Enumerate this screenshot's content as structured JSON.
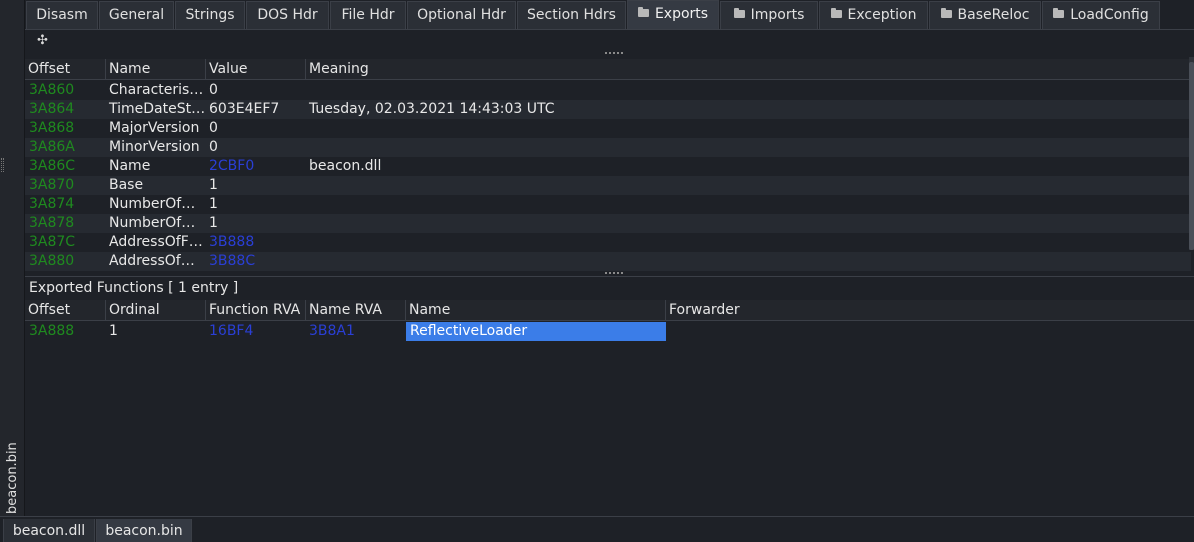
{
  "tabs": [
    {
      "label": "Disasm",
      "folder": false
    },
    {
      "label": "General",
      "folder": false
    },
    {
      "label": "Strings",
      "folder": false
    },
    {
      "label": "DOS Hdr",
      "folder": false
    },
    {
      "label": "File Hdr",
      "folder": false
    },
    {
      "label": "Optional Hdr",
      "folder": false
    },
    {
      "label": "Section Hdrs",
      "folder": false
    },
    {
      "label": "Exports",
      "folder": true,
      "active": true
    },
    {
      "label": "Imports",
      "folder": true
    },
    {
      "label": "Exception",
      "folder": true
    },
    {
      "label": "BaseReloc",
      "folder": true
    },
    {
      "label": "LoadConfig",
      "folder": true
    }
  ],
  "toolbar": {
    "move_icon": "move-icon"
  },
  "side_label": "beacon.bin",
  "export_dir": {
    "headers": [
      "Offset",
      "Name",
      "Value",
      "Meaning"
    ],
    "rows": [
      {
        "offset": "3A860",
        "name": "Characteris…",
        "value": "0",
        "value_link": false,
        "meaning": ""
      },
      {
        "offset": "3A864",
        "name": "TimeDateSt…",
        "value": "603E4EF7",
        "value_link": false,
        "meaning": "Tuesday, 02.03.2021 14:43:03 UTC"
      },
      {
        "offset": "3A868",
        "name": "MajorVersion",
        "value": "0",
        "value_link": false,
        "meaning": ""
      },
      {
        "offset": "3A86A",
        "name": "MinorVersion",
        "value": "0",
        "value_link": false,
        "meaning": ""
      },
      {
        "offset": "3A86C",
        "name": "Name",
        "value": "2CBF0",
        "value_link": true,
        "meaning": "beacon.dll"
      },
      {
        "offset": "3A870",
        "name": "Base",
        "value": "1",
        "value_link": false,
        "meaning": ""
      },
      {
        "offset": "3A874",
        "name": "NumberOf…",
        "value": "1",
        "value_link": false,
        "meaning": ""
      },
      {
        "offset": "3A878",
        "name": "NumberOf…",
        "value": "1",
        "value_link": false,
        "meaning": ""
      },
      {
        "offset": "3A87C",
        "name": "AddressOfF…",
        "value": "3B888",
        "value_link": true,
        "meaning": ""
      },
      {
        "offset": "3A880",
        "name": "AddressOf…",
        "value": "3B88C",
        "value_link": true,
        "meaning": ""
      }
    ]
  },
  "exported_functions": {
    "title": "Exported Functions   [ 1 entry ]",
    "headers": [
      "Offset",
      "Ordinal",
      "Function RVA",
      "Name RVA",
      "Name",
      "Forwarder"
    ],
    "rows": [
      {
        "offset": "3A888",
        "ordinal": "1",
        "function_rva": "16BF4",
        "name_rva": "3B8A1",
        "name": "ReflectiveLoader",
        "forwarder": ""
      }
    ]
  },
  "bottom_tabs": [
    {
      "label": "beacon.dll"
    },
    {
      "label": "beacon.bin",
      "active": true
    }
  ],
  "colors": {
    "offset": "#1f8a1f",
    "link": "#2a3fd6",
    "selection": "#3b7de8"
  }
}
